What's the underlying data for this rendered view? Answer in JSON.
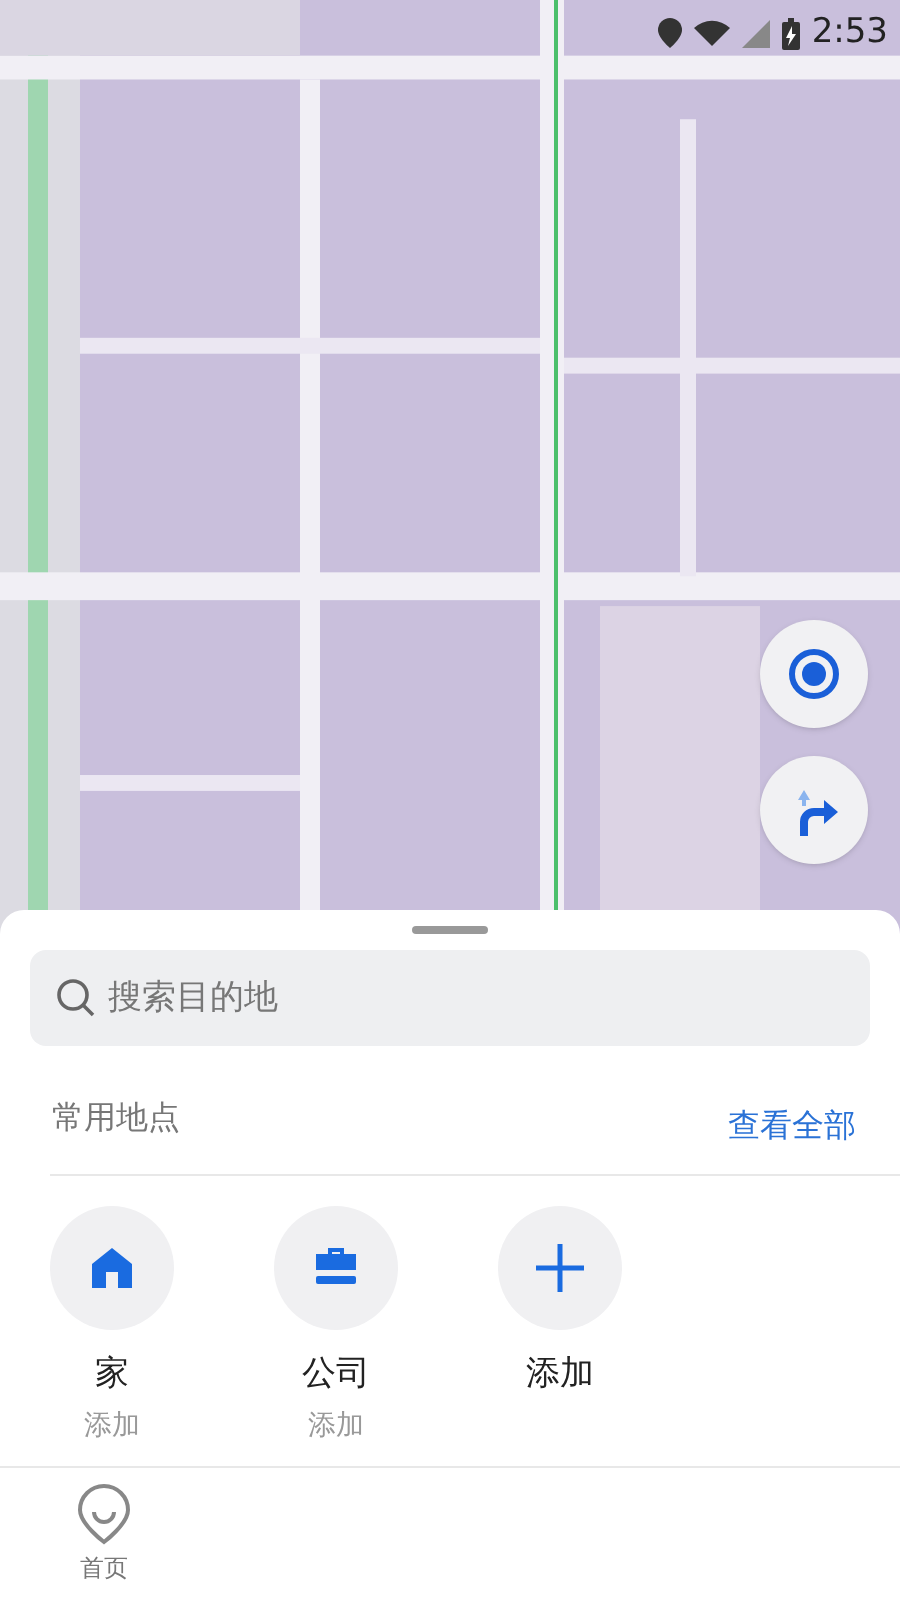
{
  "status_bar": {
    "time": "2:53"
  },
  "map_controls": [
    {
      "kind": "locate"
    },
    {
      "kind": "route"
    }
  ],
  "search": {
    "placeholder": "搜索目的地"
  },
  "frequent_places": {
    "title": "常用地点",
    "view_all": "查看全部",
    "items": [
      {
        "kind": "home",
        "label": "家",
        "sublabel": "添加"
      },
      {
        "kind": "work",
        "label": "公司",
        "sublabel": "添加"
      },
      {
        "kind": "add",
        "label": "添加"
      }
    ]
  },
  "bottom_nav": [
    {
      "kind": "home",
      "label": "首页"
    }
  ]
}
